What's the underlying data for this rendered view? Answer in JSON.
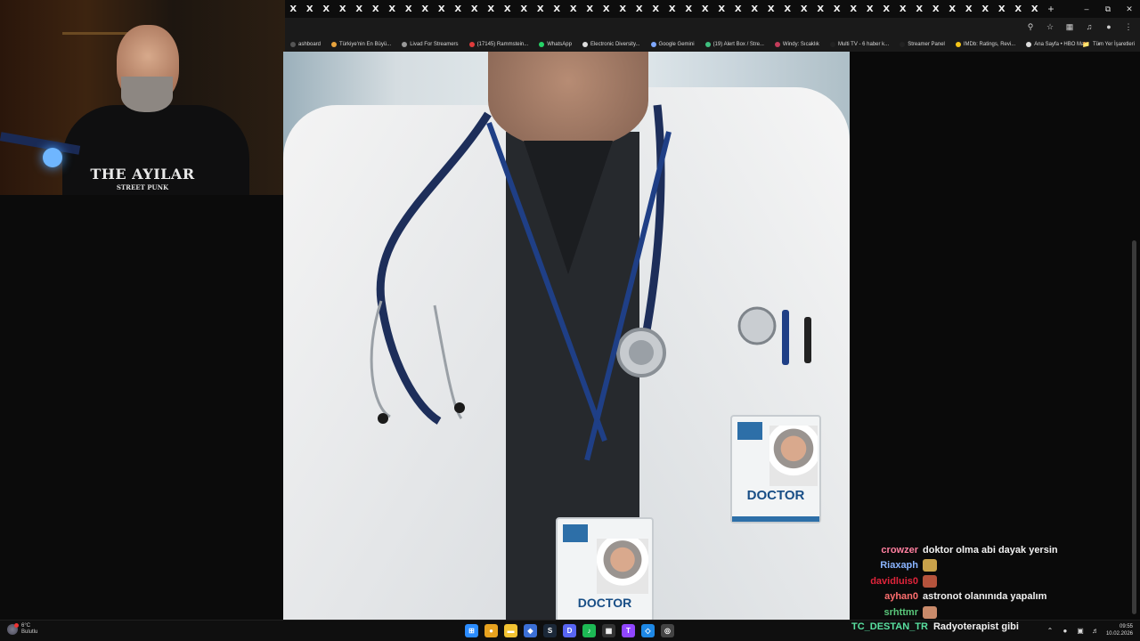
{
  "browser": {
    "tabs": [
      "X",
      "X",
      "X",
      "X",
      "X",
      "X",
      "X",
      "X",
      "X",
      "X",
      "X",
      "X",
      "X",
      "X",
      "X",
      "X",
      "X",
      "X",
      "X",
      "X",
      "X",
      "X",
      "X",
      "X",
      "X",
      "X",
      "X",
      "X",
      "X",
      "X",
      "X",
      "X",
      "X",
      "X",
      "X",
      "X",
      "X",
      "X",
      "X",
      "X",
      "X",
      "X",
      "X",
      "X",
      "X",
      "X"
    ],
    "new_tab": "+",
    "window_controls": [
      "–",
      "⧉",
      "✕"
    ],
    "toolbar_icons": [
      "zoom-icon",
      "star-icon",
      "extensions-icon",
      "media-icon",
      "profile-icon",
      "menu-icon"
    ],
    "bookmarks": [
      {
        "label": "ashboard",
        "color": "#555"
      },
      {
        "label": "Türkiye'nin En Büyü...",
        "color": "#e8a33d"
      },
      {
        "label": "Livad For Streamers",
        "color": "#999"
      },
      {
        "label": "(17145) Rammstein...",
        "color": "#e03b3b"
      },
      {
        "label": "WhatsApp",
        "color": "#25d366"
      },
      {
        "label": "Electronic Diversity...",
        "color": "#ddd"
      },
      {
        "label": "Google Gemini",
        "color": "#7fa8ff"
      },
      {
        "label": "(19) Alert Box / Stre...",
        "color": "#3fbf7f"
      },
      {
        "label": "Windy: Sıcaklık",
        "color": "#c43c5a"
      },
      {
        "label": "Multi TV - 6 haber k...",
        "color": "#222"
      },
      {
        "label": "Streamer Panel",
        "color": "#222"
      },
      {
        "label": "IMDb: Ratings, Revi...",
        "color": "#f5c518"
      },
      {
        "label": "Ana Sayfa • HBO Max",
        "color": "#ddd"
      }
    ],
    "bookmarks_more": "»",
    "all_bookmarks": "Tüm Yer İşaretleri"
  },
  "webcam": {
    "shirt_text": "THE AYILAR",
    "shirt_sub": "STREET PUNK"
  },
  "image": {
    "badge_label": "DOCTOR"
  },
  "chat": [
    {
      "user": "crowzer",
      "color": "#ff7f9f",
      "message": "doktor olma abi dayak yersin",
      "emote": ""
    },
    {
      "user": "Riaxaph",
      "color": "#8ab4ff",
      "message": "",
      "emote": "#c9a24a"
    },
    {
      "user": "davidluis0",
      "color": "#e0243a",
      "message": "",
      "emote": "#b5533c"
    },
    {
      "user": "ayhan0",
      "color": "#ff6f6f",
      "message": "astronot olanınıda yapalım",
      "emote": ""
    },
    {
      "user": "srhttmr",
      "color": "#59c77a",
      "message": "",
      "emote": "#c98a6a"
    }
  ],
  "ticker": {
    "user": "TC_DESTAN_TR",
    "user_color": "#59e0a0",
    "message": "Radyoterapist gibi"
  },
  "taskbar": {
    "weather_temp": "6°C",
    "weather_desc": "Bulutlu",
    "apps": [
      {
        "name": "windows-start-icon",
        "color": "#2b8cff",
        "glyph": "⊞"
      },
      {
        "name": "chrome-icon",
        "color": "#e7a21f",
        "glyph": "●"
      },
      {
        "name": "file-explorer-icon",
        "color": "#f1c232",
        "glyph": "▬"
      },
      {
        "name": "app-blue-icon",
        "color": "#3b6fd6",
        "glyph": "◆"
      },
      {
        "name": "steam-icon",
        "color": "#1b2838",
        "glyph": "S"
      },
      {
        "name": "discord-icon",
        "color": "#5865f2",
        "glyph": "D"
      },
      {
        "name": "spotify-icon",
        "color": "#1db954",
        "glyph": "♪"
      },
      {
        "name": "calculator-icon",
        "color": "#333",
        "glyph": "▦"
      },
      {
        "name": "twitch-icon",
        "color": "#9146ff",
        "glyph": "T"
      },
      {
        "name": "app-cyan-icon",
        "color": "#1e88e5",
        "glyph": "◇"
      },
      {
        "name": "obs-icon",
        "color": "#444",
        "glyph": "◎"
      }
    ],
    "time": "09:55",
    "date": "10.02.2026"
  }
}
